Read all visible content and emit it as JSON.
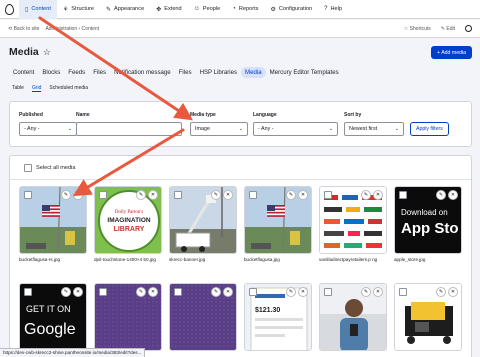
{
  "topnav": [
    {
      "label": "Content",
      "icon": "document-icon",
      "glyph": "▯",
      "active": true
    },
    {
      "label": "Structure",
      "icon": "structure-icon",
      "glyph": "⚘",
      "active": false
    },
    {
      "label": "Appearance",
      "icon": "brush-icon",
      "glyph": "✎",
      "active": false
    },
    {
      "label": "Extend",
      "icon": "puzzle-icon",
      "glyph": "✥",
      "active": false
    },
    {
      "label": "People",
      "icon": "people-icon",
      "glyph": "☺",
      "active": false
    },
    {
      "label": "Reports",
      "icon": "chart-icon",
      "glyph": "◔",
      "active": false
    },
    {
      "label": "Configuration",
      "icon": "wrench-icon",
      "glyph": "⚙",
      "active": false
    },
    {
      "label": "Help",
      "icon": "help-icon",
      "glyph": "?",
      "active": false
    }
  ],
  "secbar": {
    "back": "⟲ Back to site",
    "breadcrumb": "Administration › Content",
    "shortcuts": "☆ Shortcuts",
    "edit": "✎ Edit"
  },
  "page": {
    "title": "Media",
    "star": "☆",
    "add_button": "+ Add media"
  },
  "primary_tabs": [
    "Content",
    "Blocks",
    "Feeds",
    "Files",
    "Notification message",
    "Files",
    "HSP Libraries",
    "Media",
    "Mercury Editor Templates"
  ],
  "primary_active": 7,
  "secondary_tabs": [
    "Table",
    "Grid",
    "Scheduled media"
  ],
  "secondary_active": 1,
  "filters": {
    "published": {
      "label": "Published",
      "value": "- Any -"
    },
    "name": {
      "label": "Name",
      "value": ""
    },
    "media_type": {
      "label": "Media type",
      "value": "Image"
    },
    "language": {
      "label": "Language",
      "value": "- Any -"
    },
    "sort_by": {
      "label": "Sort by",
      "value": "Newest first"
    },
    "apply": "Apply filters"
  },
  "grid": {
    "select_all": "Select all media",
    "items": [
      {
        "name": "bucketflagusa-rs.jpg",
        "thumb": "flag-pole"
      },
      {
        "name": "dpil-touchstone-1400×4 50.jpg",
        "thumb": "imagination-library"
      },
      {
        "name": "skrecc-banner.jpg",
        "thumb": "bucket-truck"
      },
      {
        "name": "bucketflagusa.jpg",
        "thumb": "flag-pole"
      },
      {
        "name": "vanilladirectpayretailers.p ng",
        "thumb": "retailer-logos"
      },
      {
        "name": "apple_store.jpg",
        "thumb": "app-store"
      },
      {
        "name": "",
        "thumb": "google-play"
      },
      {
        "name": "",
        "thumb": "purple"
      },
      {
        "name": "",
        "thumb": "purple"
      },
      {
        "name": "",
        "thumb": "phone-app"
      },
      {
        "name": "",
        "thumb": "person-phone"
      },
      {
        "name": "",
        "thumb": "generator"
      }
    ]
  },
  "thumb_text": {
    "imagination": "IMAGINATION",
    "library": "LIBRARY",
    "download": "Download on",
    "appstore": "App Sto",
    "getit": "GET IT ON",
    "google": "Google",
    "phone_amount": "$121.30"
  },
  "status_url": "https://dev-cwb-skrecc2-shine.pantheonsite.io/media/383/edit?des...",
  "colors": {
    "accent": "#003ecc",
    "arrow": "#e8593f"
  }
}
